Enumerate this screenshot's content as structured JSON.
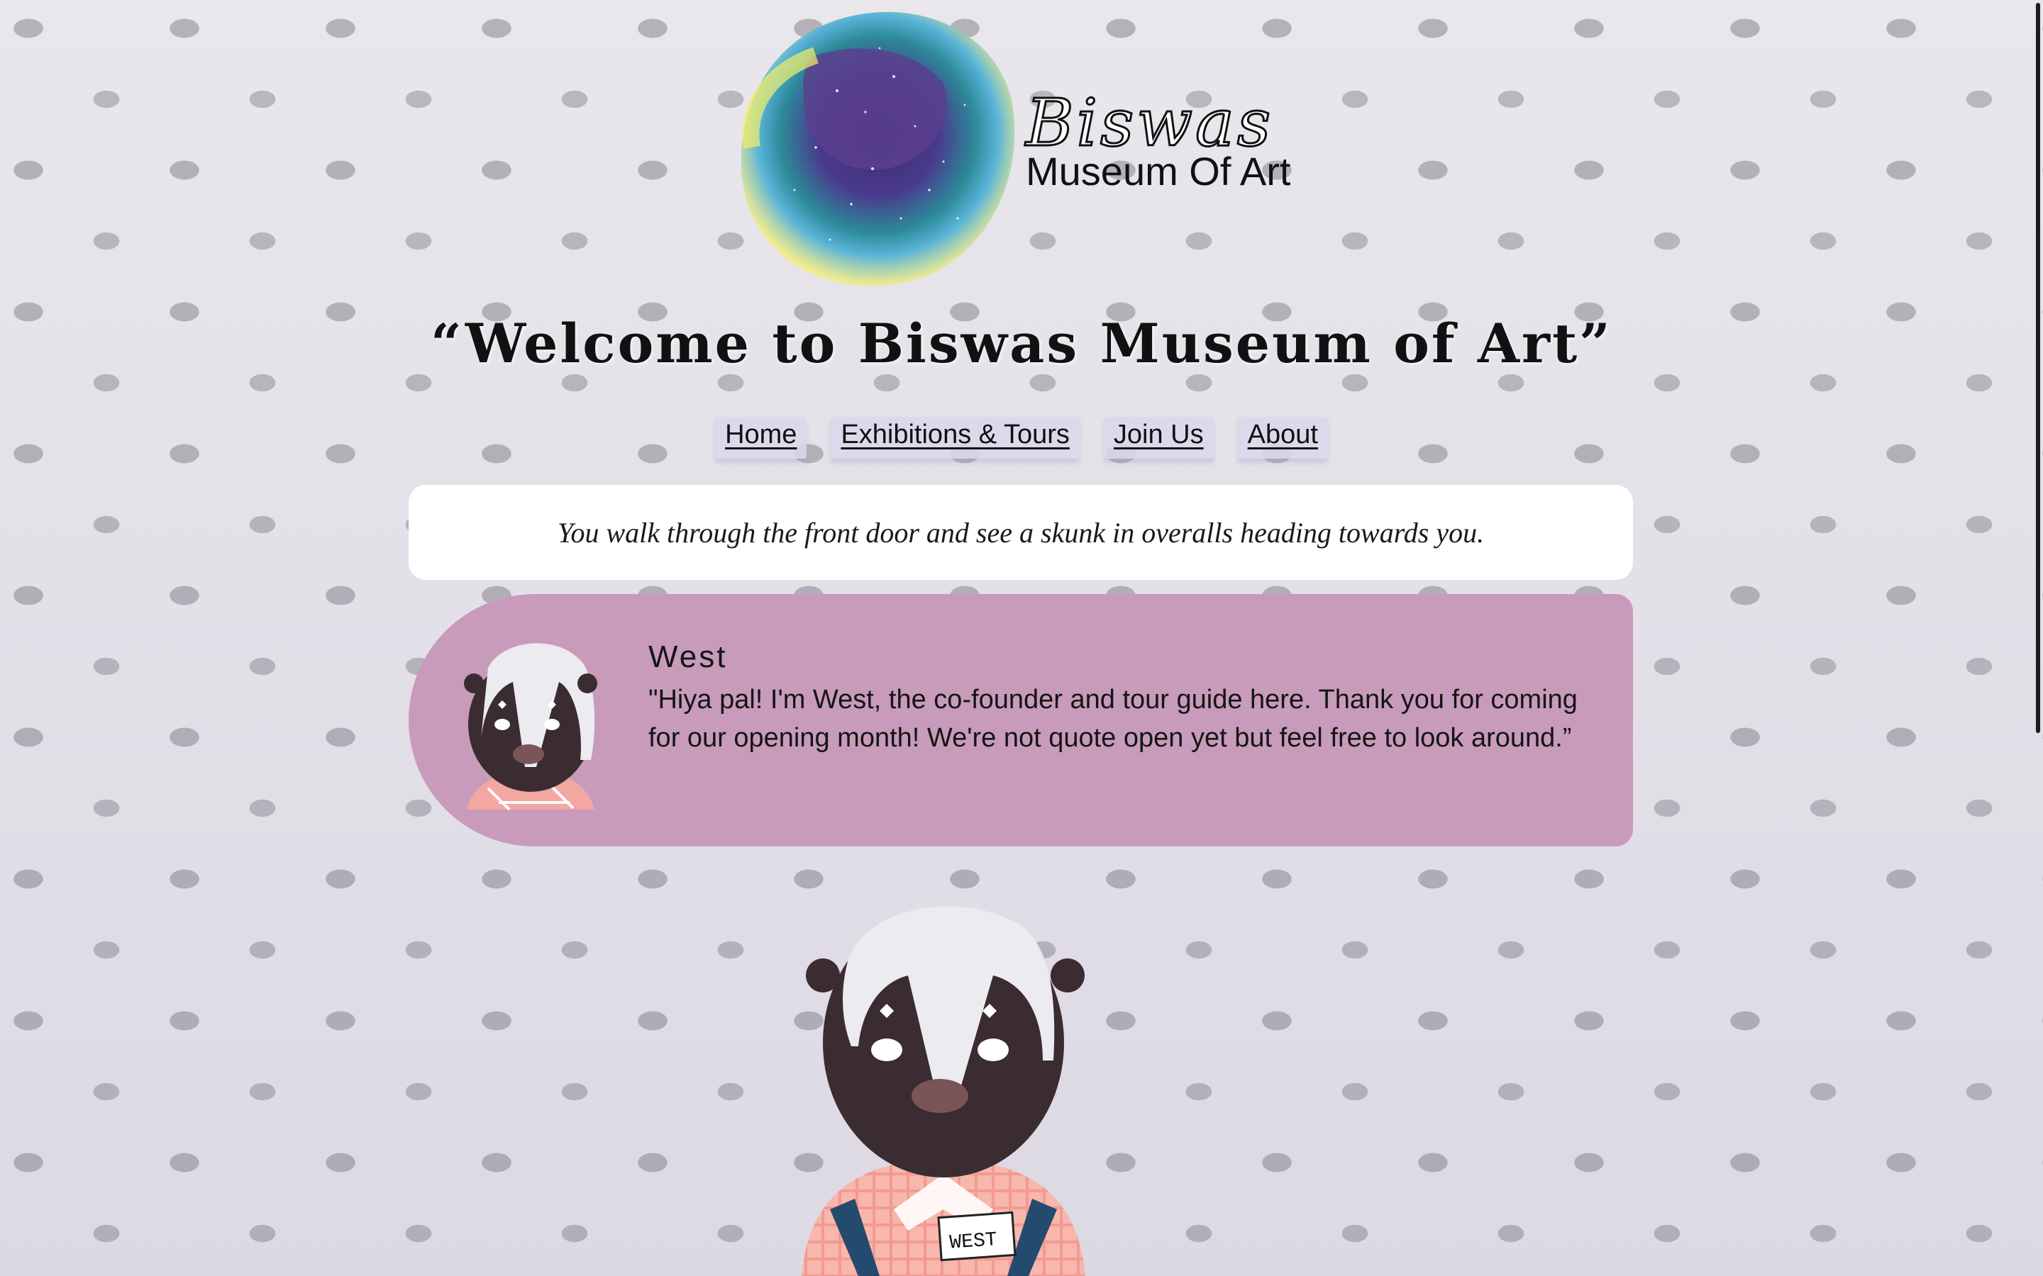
{
  "logo": {
    "title": "Biswas",
    "subtitle": "Museum Of Art"
  },
  "headline": "“Welcome to Biswas Museum of Art”",
  "nav": {
    "items": [
      {
        "label": "Home"
      },
      {
        "label": "Exhibitions & Tours"
      },
      {
        "label": "Join Us"
      },
      {
        "label": "About"
      }
    ]
  },
  "narration": {
    "text": "You walk through the front door and see a skunk in overalls heading towards you."
  },
  "dialogue": {
    "speaker": "West",
    "text": "\"Hiya pal! I'm West, the co-founder and tour guide here. Thank you for coming for our opening month! We're not quote open yet but feel free to look around.”"
  },
  "character": {
    "name_tag": "WEST"
  },
  "colors": {
    "dialogue_bg": "#c89bba",
    "narration_bg": "#ffffff",
    "nav_bg": "#dcd7eb"
  },
  "icons": {
    "logo": "watercolor-galaxy-blob",
    "avatar": "skunk-portrait",
    "character": "skunk-in-overalls"
  }
}
